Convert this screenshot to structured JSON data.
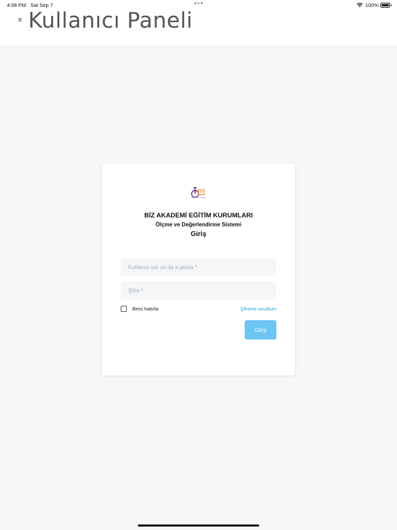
{
  "status_bar": {
    "time": "4:08 PM",
    "date": "Sat Sep 7",
    "battery": "100%",
    "battery_level": 1.0,
    "wifi_icon": "wifi-icon",
    "battery_icon": "battery-icon"
  },
  "header": {
    "title": "Kullanıcı Paneli",
    "menu_icon": "hamburger-menu-icon",
    "menu_glyph": "≡"
  },
  "login": {
    "logo_icon": "biz-akademi-logo",
    "organization": "BİZ AKADEMİ EĞİTİM KURUMLARI",
    "system": "Ölçme ve Değerlendirme Sistemi",
    "heading": "Giriş",
    "username_placeholder": "Kullanıcı adı ya da e-posta *",
    "password_placeholder": "Şifre *",
    "remember_label": "Beni hatırla",
    "remember_checked": false,
    "forgot_link": "Şifremi unuttum",
    "submit_label": "Giriş"
  },
  "colors": {
    "background": "#f6f7f7",
    "card": "#ffffff",
    "accent": "#6cc5f3",
    "link": "#29a3dd",
    "logo_purple": "#6a2c8c",
    "logo_orange": "#f28c28"
  }
}
